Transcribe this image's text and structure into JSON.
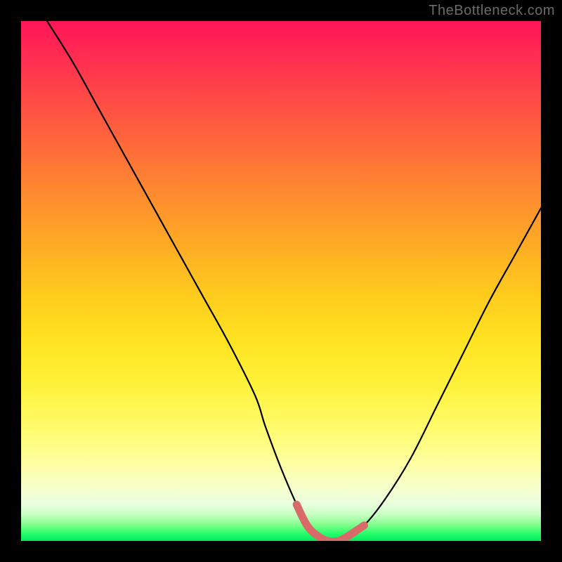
{
  "watermark": "TheBottleneck.com",
  "colors": {
    "frame": "#000000",
    "curve": "#000000",
    "highlight": "#d86a6a",
    "gradient_stops": [
      "#ff1458",
      "#ff2a52",
      "#ff4747",
      "#ff6a3a",
      "#ff8a2f",
      "#ffab24",
      "#ffc91e",
      "#ffe220",
      "#fff23a",
      "#fffb6a",
      "#fdffa0",
      "#f6ffce",
      "#e8ffde",
      "#c7ffc2",
      "#7dff8a",
      "#2bff6a",
      "#00e864"
    ]
  },
  "chart_data": {
    "type": "line",
    "title": "",
    "xlabel": "",
    "ylabel": "",
    "xlim": [
      0,
      100
    ],
    "ylim": [
      0,
      100
    ],
    "x": [
      5,
      10,
      15,
      20,
      25,
      30,
      35,
      40,
      45,
      47,
      50,
      53,
      55,
      57,
      59,
      61,
      63,
      66,
      70,
      75,
      80,
      85,
      90,
      95,
      100
    ],
    "values": [
      100,
      92,
      83,
      74,
      65,
      56,
      47,
      38,
      28,
      22,
      14,
      7,
      3,
      1,
      0,
      0,
      1,
      3,
      8,
      16,
      26,
      36,
      46,
      55,
      64
    ],
    "highlight_region": {
      "start_index": 11,
      "end_index": 17
    },
    "note": "x and y are percentages of the plot area; values read off shape of the V-curve (no axis ticks present)"
  }
}
